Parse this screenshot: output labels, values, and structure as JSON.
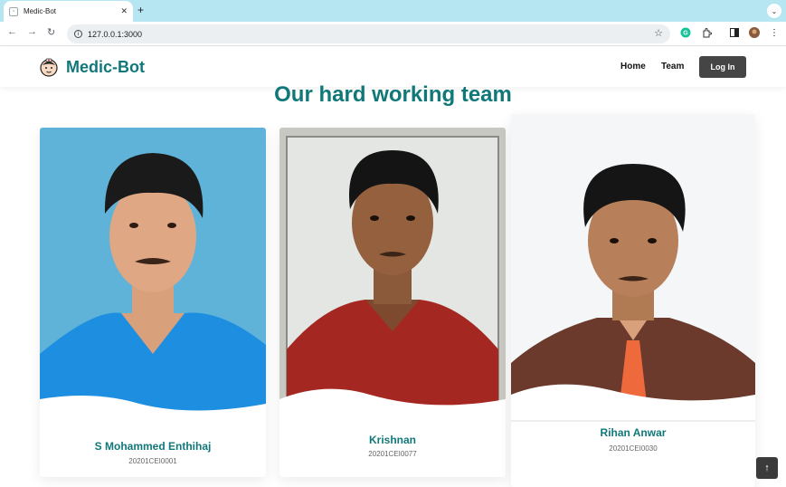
{
  "browser": {
    "tab_title": "Medic-Bot",
    "tab_close": "✕",
    "new_tab": "+",
    "url": "127.0.0.1:3000"
  },
  "site": {
    "brand": "Medic-Bot",
    "nav": {
      "home": "Home",
      "team": "Team",
      "login": "Log In"
    }
  },
  "page": {
    "heading": "Our hard working team",
    "members": [
      {
        "name": "S Mohammed Enthihaj",
        "roll": "20201CEI0001"
      },
      {
        "name": "Krishnan",
        "roll": "20201CEI0077"
      },
      {
        "name": "Rihan Anwar",
        "roll": "20201CEI0030"
      }
    ]
  },
  "colors": {
    "brand": "#11787a",
    "tabbar": "#b6e6f2",
    "button": "#454545"
  },
  "icons": [
    "back-icon",
    "forward-icon",
    "reload-icon",
    "info-icon",
    "star-icon",
    "grammarly-icon",
    "extensions-icon",
    "sidebar-icon",
    "profile-avatar",
    "more-icon",
    "scroll-top-icon"
  ]
}
